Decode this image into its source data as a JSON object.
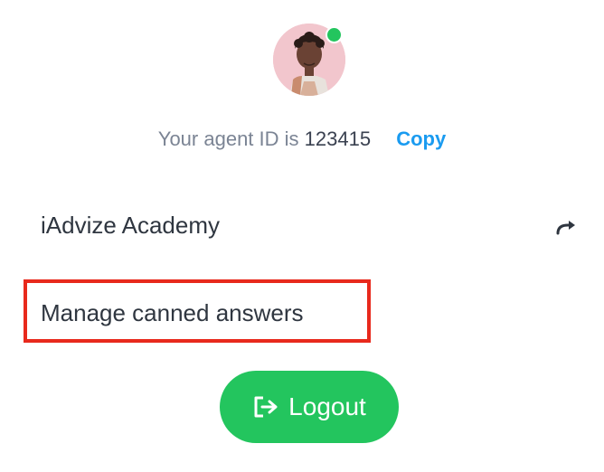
{
  "profile": {
    "avatar_alt": "agent avatar",
    "status": "online",
    "status_color": "#23c55e"
  },
  "agent_id": {
    "label": "Your agent ID is",
    "value": "123415",
    "copy_label": "Copy"
  },
  "menu": {
    "academy_label": "iAdvize Academy",
    "academy_icon": "external-link-arrow-icon",
    "canned_answers_label": "Manage canned answers"
  },
  "logout": {
    "label": "Logout",
    "icon": "logout-icon"
  },
  "colors": {
    "accent": "#1a9bf0",
    "success": "#23c55e",
    "highlight": "#e8291c"
  }
}
